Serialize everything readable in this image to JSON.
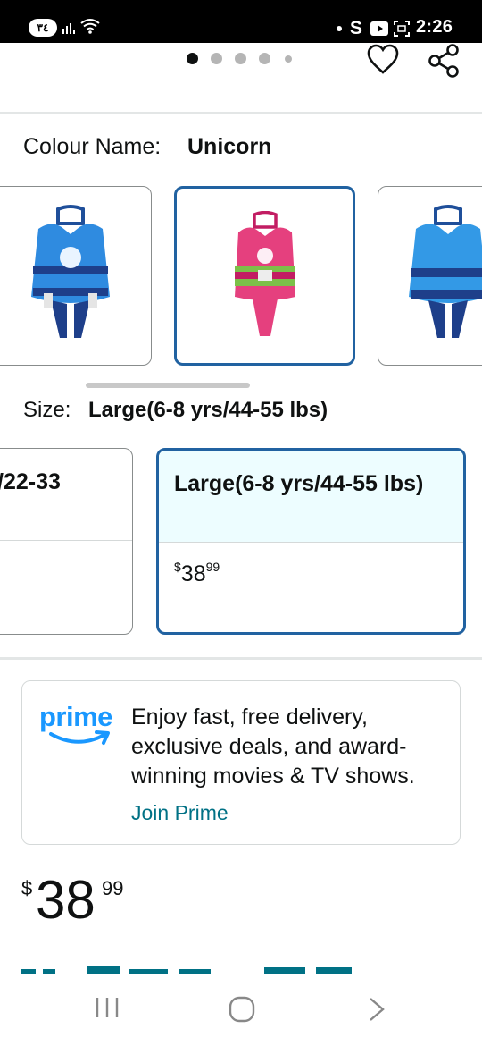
{
  "status_bar": {
    "sim_badge": "٣٤",
    "time": "2:26",
    "s_indicator": "S"
  },
  "gallery": {
    "page_dots": 5,
    "active_dot": 0,
    "favorite_icon": "heart-outline-icon",
    "share_icon": "share-icon"
  },
  "colour": {
    "label": "Colour Name:",
    "value": "Unicorn",
    "swatch_colors": [
      "#2f8be0",
      "#e5407e",
      "#3399e6"
    ]
  },
  "size": {
    "label": "Size:",
    "value": "Large(6-8 yrs/44-55 lbs)"
  },
  "size_options": [
    {
      "title": "/22-33",
      "price_symbol": "",
      "price_whole": "",
      "price_fraction": ""
    },
    {
      "title": "Large(6-8 yrs/44-55 lbs)",
      "price_symbol": "$",
      "price_whole": "38",
      "price_fraction": "99"
    }
  ],
  "prime": {
    "logo_text": "prime",
    "message": "Enjoy fast, free delivery, exclusive deals, and award-winning movies & TV shows.",
    "link": "Join Prime"
  },
  "price": {
    "symbol": "$",
    "whole": "38",
    "fraction": "99"
  },
  "colors": {
    "accent_blue": "#2162a1",
    "prime_blue": "#1a98ff",
    "link": "#007185"
  }
}
